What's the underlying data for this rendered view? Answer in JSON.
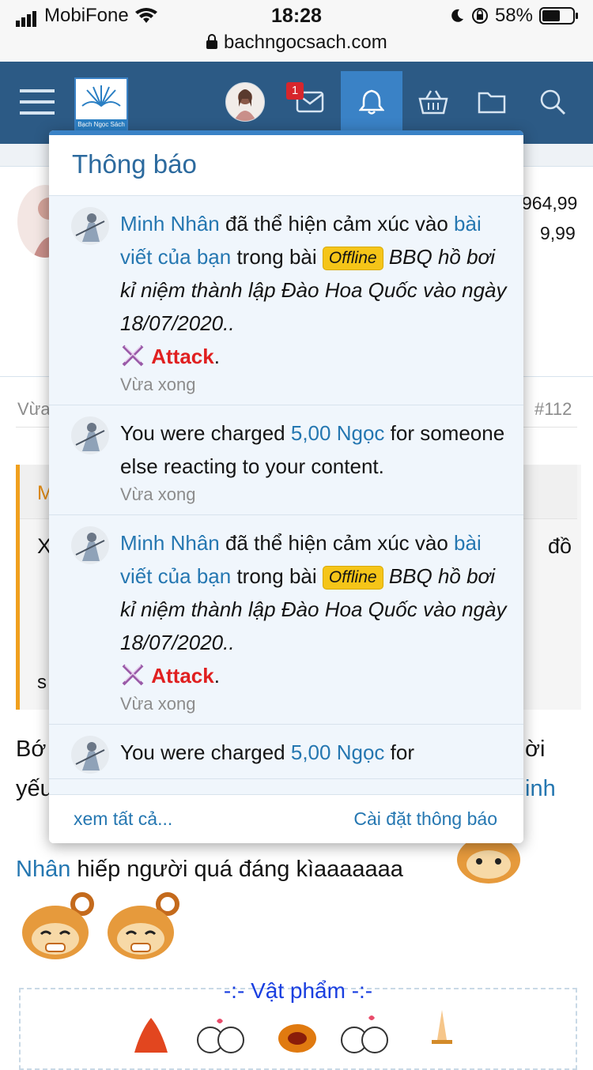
{
  "status_bar": {
    "carrier": "MobiFone",
    "time": "18:28",
    "battery": "58%",
    "url": "bachngocsach.com"
  },
  "nav": {
    "logo_text": "Bạch Ngọc Sách",
    "inbox_badge": "1"
  },
  "background": {
    "stat_1": "964,99",
    "stat_2": "9,99",
    "post_time_partial": "Vừa",
    "post_number": "#112",
    "quote_initial": "M",
    "quote_line_start": "X",
    "quote_line_end": "đồ",
    "quote_line_3": "s",
    "body_line_1_start": "Bớ",
    "body_line_1_end": "ời",
    "body_line_2_start": "yếu",
    "body_line_2_end": "inh",
    "body_line_3_link": "Nhân",
    "body_line_3_text": "hiếp người quá đáng kìaaaaaaa",
    "item_header": "-:- Vật phẩm -:-"
  },
  "popup": {
    "title": "Thông báo",
    "notifications": [
      {
        "user": "Minh Nhân",
        "action": "đã thể hiện cảm xúc vào",
        "link": "bài viết của bạn",
        "mid": "trong bài",
        "tag": "Offline",
        "thread": "BBQ hồ bơi kỉ niệm thành lập Đào Hoa Quốc vào ngày 18/07/2020..",
        "reaction": "Attack",
        "time": "Vừa xong"
      },
      {
        "pre": "You were charged",
        "amount": "5,00 Ngọc",
        "post": "for someone else reacting to your content.",
        "time": "Vừa xong"
      },
      {
        "user": "Minh Nhân",
        "action": "đã thể hiện cảm xúc vào",
        "link": "bài viết của bạn",
        "mid": "trong bài",
        "tag": "Offline",
        "thread": "BBQ hồ bơi kỉ niệm thành lập Đào Hoa Quốc vào ngày 18/07/2020..",
        "reaction": "Attack",
        "time": "Vừa xong"
      },
      {
        "pre": "You were charged",
        "amount": "5,00 Ngọc",
        "post": "for",
        "time": ""
      }
    ],
    "footer_left": "xem tất cả...",
    "footer_right": "Cài đặt thông báo"
  }
}
